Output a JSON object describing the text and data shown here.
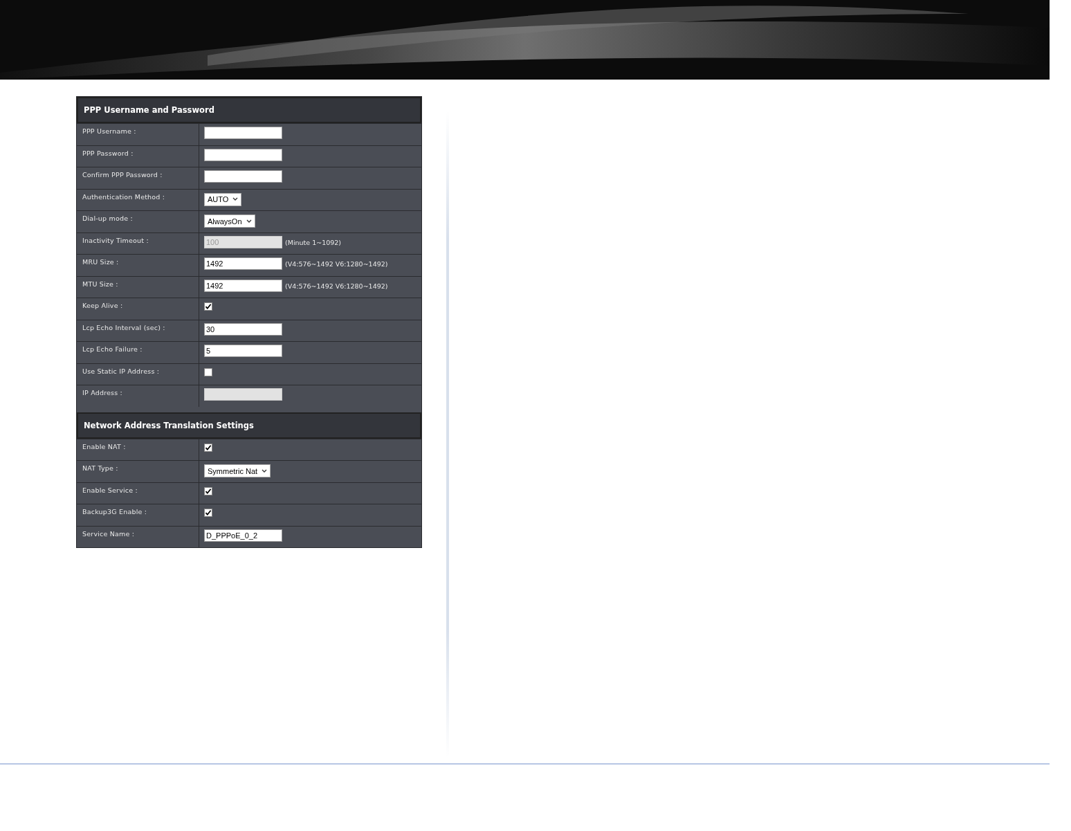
{
  "sections": [
    {
      "title": "PPP Username and Password",
      "rows": [
        {
          "label": "PPP Username :",
          "kind": "text",
          "value": "",
          "disabled": false
        },
        {
          "label": "PPP Password :",
          "kind": "password",
          "value": "",
          "disabled": false
        },
        {
          "label": "Confirm PPP Password :",
          "kind": "password",
          "value": "",
          "disabled": false
        },
        {
          "label": "Authentication Method :",
          "kind": "select",
          "value": "AUTO"
        },
        {
          "label": "Dial-up mode :",
          "kind": "select",
          "value": "AlwaysOn"
        },
        {
          "label": "Inactivity Timeout :",
          "kind": "text",
          "value": "100",
          "disabled": true,
          "hint": "(Minute 1~1092)"
        },
        {
          "label": "MRU Size :",
          "kind": "text",
          "value": "1492",
          "disabled": false,
          "hint": "(V4:576~1492 V6:1280~1492)"
        },
        {
          "label": "MTU Size :",
          "kind": "text",
          "value": "1492",
          "disabled": false,
          "hint": "(V4:576~1492 V6:1280~1492)"
        },
        {
          "label": "Keep Alive :",
          "kind": "checkbox",
          "checked": true
        },
        {
          "label": "Lcp Echo Interval (sec) :",
          "kind": "text",
          "value": "30",
          "disabled": false
        },
        {
          "label": "Lcp Echo Failure :",
          "kind": "text",
          "value": "5",
          "disabled": false
        },
        {
          "label": "Use Static IP Address :",
          "kind": "checkbox",
          "checked": false
        },
        {
          "label": "IP Address :",
          "kind": "text",
          "value": "",
          "disabled": true
        }
      ]
    },
    {
      "title": "Network Address Translation Settings",
      "rows": [
        {
          "label": "Enable NAT :",
          "kind": "checkbox",
          "checked": true
        },
        {
          "label": "NAT Type :",
          "kind": "select",
          "value": "Symmetric Nat"
        },
        {
          "label": "Enable Service :",
          "kind": "checkbox",
          "checked": true
        },
        {
          "label": "Backup3G Enable :",
          "kind": "checkbox",
          "checked": true
        },
        {
          "label": "Service Name :",
          "kind": "text",
          "value": "D_PPPoE_0_2",
          "disabled": false
        }
      ]
    }
  ]
}
